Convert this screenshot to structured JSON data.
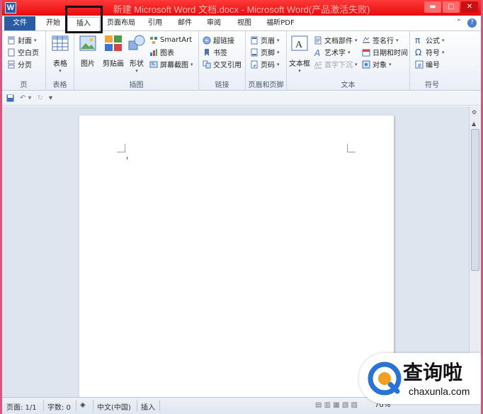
{
  "title_bar": {
    "title": "新建 Microsoft Word 文档.docx - Microsoft Word(产品激活失败)",
    "app_icon_letter": "W",
    "minimize": "▬",
    "maximize": "▢",
    "close": "✕"
  },
  "tabs": {
    "file": "文件",
    "items": [
      "开始",
      "插入",
      "页面布局",
      "引用",
      "邮件",
      "审阅",
      "视图",
      "福昕PDF"
    ],
    "active": "插入"
  },
  "ribbon": {
    "pages": {
      "cover": "封面",
      "blank": "空白页",
      "break": "分页",
      "label": "页"
    },
    "tables": {
      "table": "表格",
      "label": "表格"
    },
    "illustrations": {
      "picture": "图片",
      "clipart": "剪贴画",
      "shapes": "形状",
      "smartart": "SmartArt",
      "chart": "图表",
      "screenshot": "屏幕截图",
      "label": "插图"
    },
    "links": {
      "hyperlink": "超链接",
      "bookmark": "书签",
      "crossref": "交叉引用",
      "label": "链接"
    },
    "header_footer": {
      "header": "页眉",
      "footer": "页脚",
      "page_number": "页码",
      "label": "页眉和页脚"
    },
    "text": {
      "textbox": "文本框",
      "quickparts": "文档部件",
      "wordart": "艺术字",
      "dropcap": "首字下沉",
      "signature": "签名行",
      "datetime": "日期和时间",
      "object": "对象",
      "label": "文本"
    },
    "symbols": {
      "equation": "公式",
      "symbol": "符号",
      "number": "编号",
      "label": "符号"
    }
  },
  "status_bar": {
    "page": "页面: 1/1",
    "words": "字数: 0",
    "language": "中文(中国)",
    "mode": "插入",
    "zoom": "70%"
  },
  "watermark": {
    "title": "查询啦",
    "subtitle": "chaxunla.com"
  },
  "colors": {
    "title_bar": "#e80a0a",
    "file_tab": "#2a5ba5",
    "highlight_box": "#111111",
    "doc_background": "#dfe5ef"
  }
}
